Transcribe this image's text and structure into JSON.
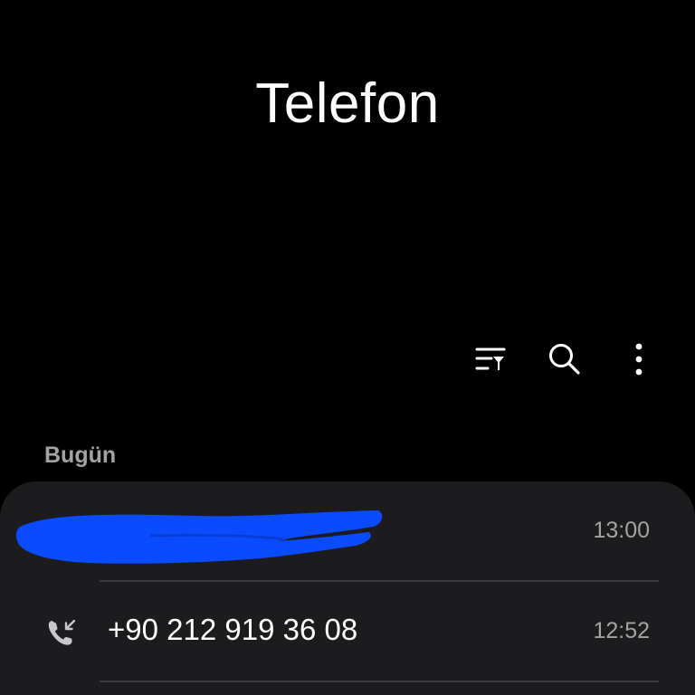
{
  "app": {
    "title": "Telefon"
  },
  "toolbar": {
    "icons": [
      "filter-icon",
      "search-icon",
      "more-options-icon"
    ]
  },
  "section": {
    "label": "Bugün"
  },
  "calls": [
    {
      "name": "",
      "time": "13:00",
      "redacted": true
    },
    {
      "name": "+90 212 919 36 08",
      "time": "12:52",
      "type": "incoming-call-icon"
    }
  ],
  "colors": {
    "background": "#000000",
    "card": "#1c1c1e",
    "secondary_text": "#a3a3a3",
    "divider": "#3a3a3c",
    "redaction": "#0b4bff"
  }
}
